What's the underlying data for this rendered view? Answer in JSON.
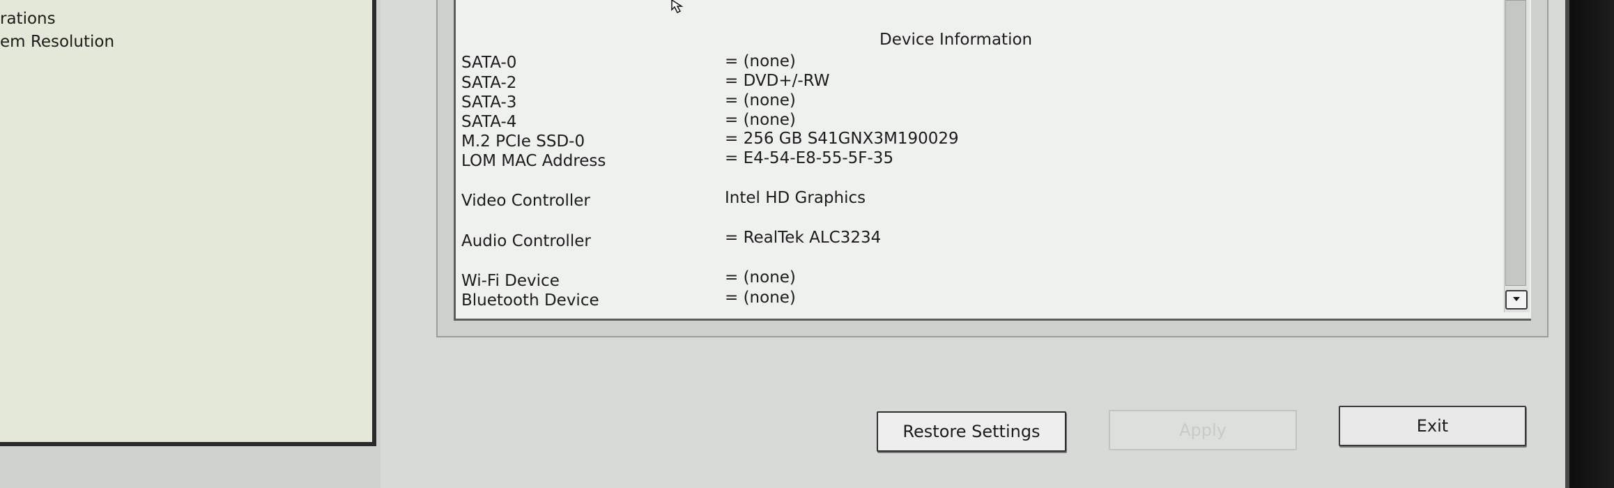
{
  "nav": {
    "items": [
      {
        "label": "rations"
      },
      {
        "label": "em Resolution"
      }
    ]
  },
  "device_info": {
    "title": "Device Information",
    "rows": [
      {
        "label": "SATA-0",
        "value": "= (none)"
      },
      {
        "label": "SATA-2",
        "value": "= DVD+/-RW"
      },
      {
        "label": "SATA-3",
        "value": "= (none)"
      },
      {
        "label": "SATA-4",
        "value": "= (none)"
      },
      {
        "label": "M.2 PCIe SSD-0",
        "value": "= 256 GB S41GNX3M190029"
      },
      {
        "label": "LOM MAC Address",
        "value": "= E4-54-E8-55-5F-35"
      },
      {
        "label": "Video Controller",
        "value": "Intel HD Graphics"
      },
      {
        "label": "Audio Controller",
        "value": "= RealTek ALC3234"
      },
      {
        "label": "Wi-Fi Device",
        "value": "= (none)"
      },
      {
        "label": "Bluetooth Device",
        "value": "= (none)"
      }
    ]
  },
  "buttons": {
    "restore": "Restore Settings",
    "apply": "Apply",
    "exit": "Exit"
  },
  "icons": {
    "cursor": "mouse-pointer-icon",
    "scroll_down": "chevron-down-icon"
  },
  "colors": {
    "panel_background": "#eff1ee",
    "nav_background": "#e4e8d8",
    "apply_disabled_text": "#c7cac6"
  }
}
